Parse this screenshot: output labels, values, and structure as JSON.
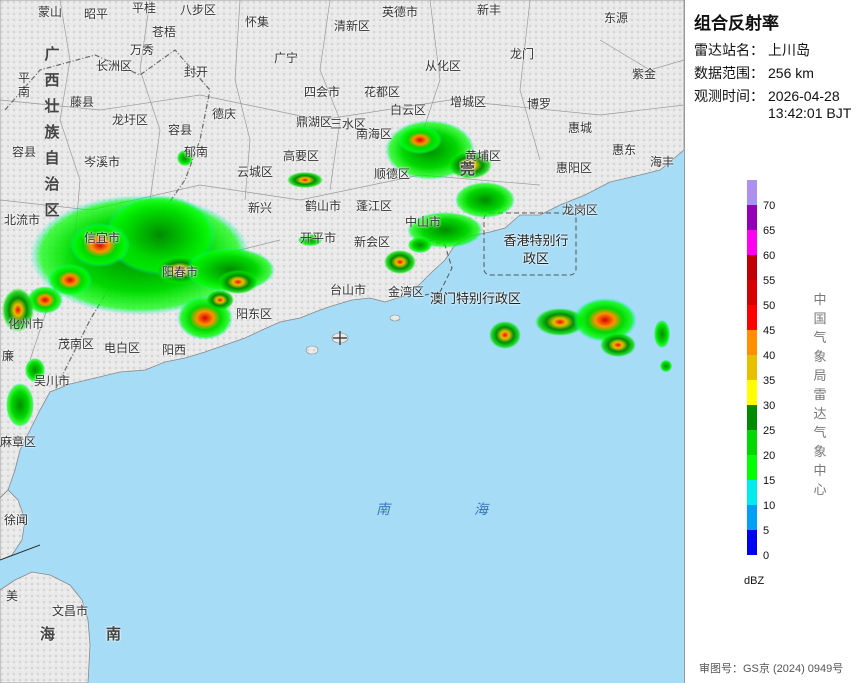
{
  "map": {
    "region_label": "广西壮族自治区",
    "hk_label": "香港特别行政区",
    "macau_label": "澳门特别行政区",
    "sea_label_1": "南",
    "sea_label_2": "海",
    "bottom_sea_1": "海",
    "bottom_sea_2": "南",
    "places": {
      "mengshan": "蒙山",
      "zhaoping": "昭平",
      "pingguai": "平桂",
      "babu": "八步区",
      "huaiji": "怀集",
      "qingxin": "清新区",
      "yingde": "英德市",
      "xinfeng": "新丰",
      "dongyuan": "东源",
      "ping": "平",
      "nan": "南",
      "changzhou": "长洲区",
      "cangwu": "苍梧",
      "wanxiu": "万秀",
      "fengkai": "封开",
      "guangning": "广宁",
      "conghua": "从化区",
      "longmen": "龙门",
      "zijin": "紫金",
      "tengxian": "藤县",
      "longxu": "龙圩区",
      "deqing": "德庆",
      "sihui": "四会市",
      "huadu": "花都区",
      "zengcheng": "增城区",
      "boluo": "博罗",
      "huicheng": "惠城",
      "rongxian": "容县",
      "cenxi": "岑溪市",
      "duanzhou": "鼎湖区",
      "gaoyao": "高要区",
      "sanshui": "三水区",
      "baiyun": "白云区",
      "nanhai": "南海区",
      "huangpu": "黄埔区",
      "huiyang": "惠阳区",
      "huidong": "惠东",
      "haifeng": "海丰",
      "yunan": "郁南",
      "yuncheng": "云城区",
      "heshan": "鹤山市",
      "pengjiang": "蓬江区",
      "shunde": "顺德区",
      "dongguan": "莞",
      "xinxing": "新兴",
      "kaiping": "开平市",
      "xinhui": "新会区",
      "zhongshan": "中山市",
      "longgang": "龙岗区",
      "beiliu": "北流市",
      "xinyi": "信宜市",
      "yangchun": "阳春市",
      "taishan": "台山市",
      "jinwan": "金湾区",
      "yangdong": "阳东区",
      "huazhou": "化州市",
      "maonan": "茂南区",
      "dianbai": "电白区",
      "yangxi": "阳西",
      "wuchuan": "吴川市",
      "lian": "廉",
      "mazhang": "麻章区",
      "xuwen": "徐闻",
      "wenchang": "文昌市",
      "meilan": "美",
      "rong": "容县"
    }
  },
  "panel": {
    "title": "组合反射率",
    "station_key": "雷达站名：",
    "station_val": "上川岛",
    "range_key": "数据范围：",
    "range_val": "256 km",
    "time_key": "观测时间：",
    "time_val_1": "2026-04-28",
    "time_val_2": "13:42:01 BJT",
    "organization": "中国气象局雷达气象中心",
    "unit": "dBZ",
    "approval": "审图号：GS京 (2024) 0949号"
  },
  "legend": {
    "bins": [
      {
        "label": "70",
        "color": "#ad90f0"
      },
      {
        "label": "65",
        "color": "#9600b4"
      },
      {
        "label": "60",
        "color": "#ff00f0"
      },
      {
        "label": "55",
        "color": "#c00000"
      },
      {
        "label": "50",
        "color": "#d60000"
      },
      {
        "label": "45",
        "color": "#ff0000"
      },
      {
        "label": "40",
        "color": "#ff9000"
      },
      {
        "label": "35",
        "color": "#e7c000"
      },
      {
        "label": "30",
        "color": "#ffff00"
      },
      {
        "label": "25",
        "color": "#008c00"
      },
      {
        "label": "20",
        "color": "#00d800"
      },
      {
        "label": "15",
        "color": "#01ff01"
      },
      {
        "label": "10",
        "color": "#00ecec"
      },
      {
        "label": "5",
        "color": "#01a0f6"
      },
      {
        "label": "0",
        "color": "#0000f6"
      }
    ]
  }
}
